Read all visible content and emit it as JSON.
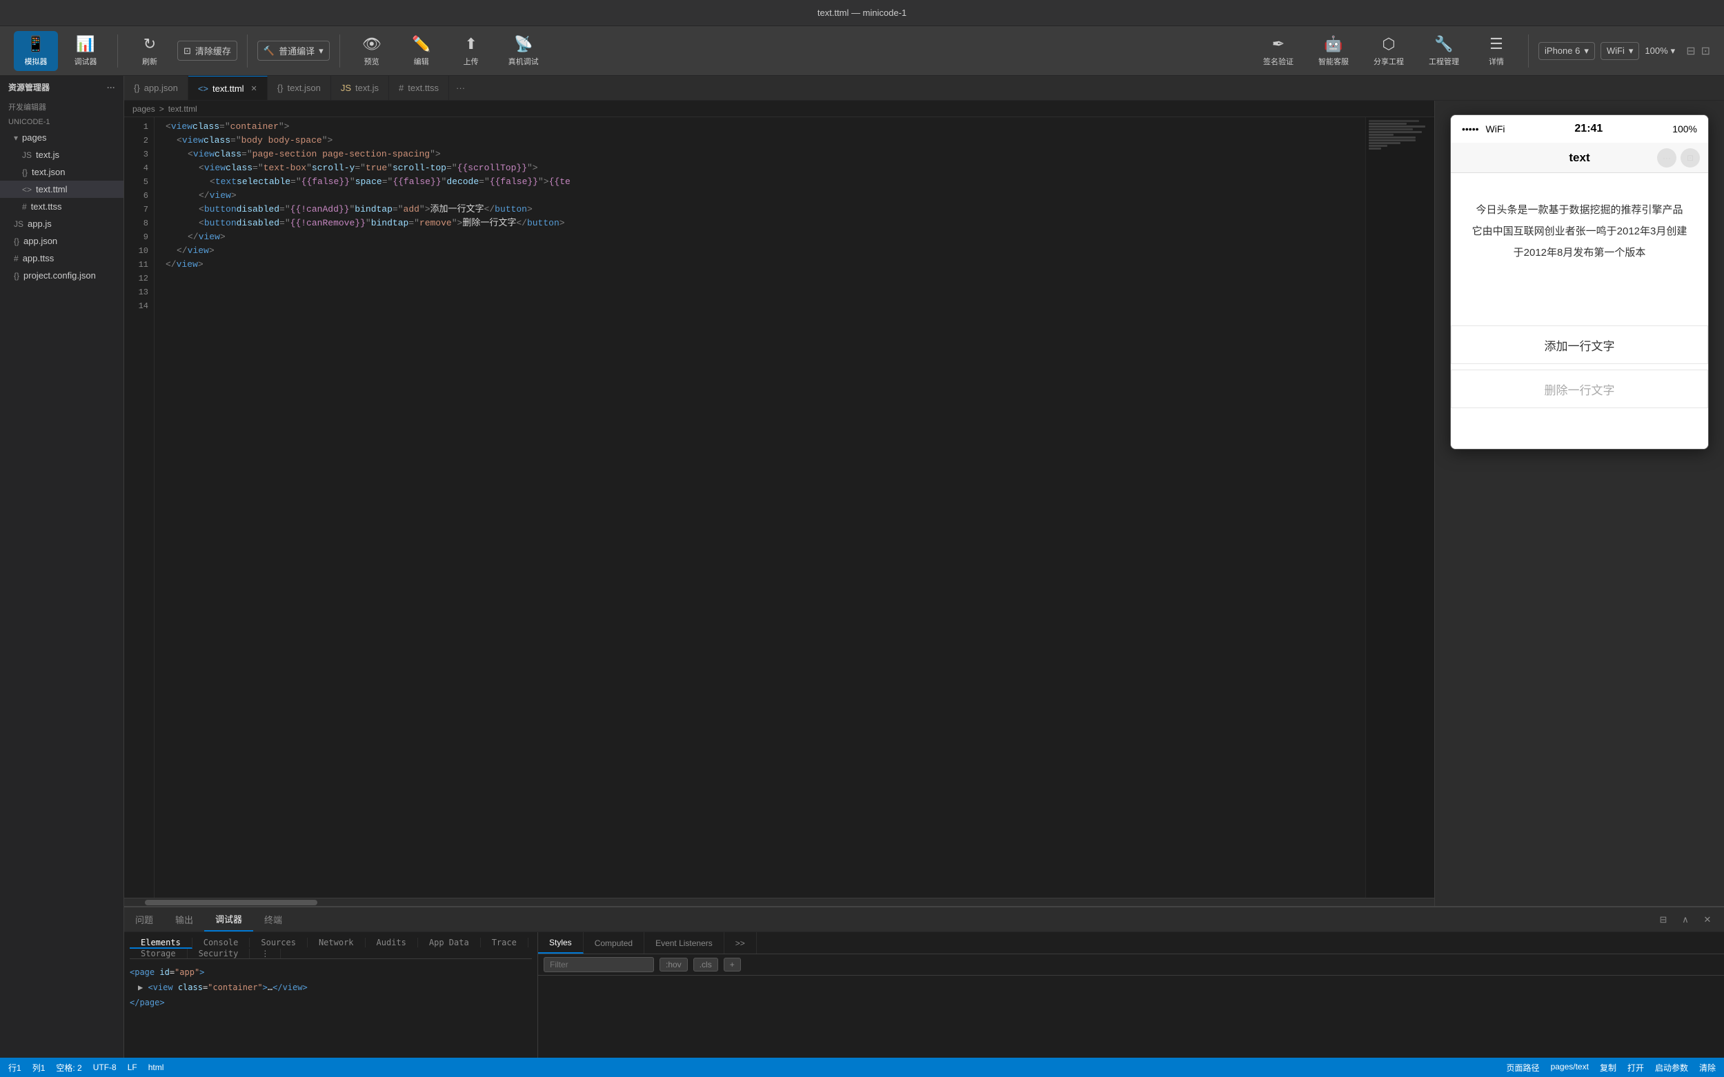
{
  "app": {
    "title": "text.ttml — minicode-1"
  },
  "toolbar": {
    "buttons": [
      {
        "id": "simulator",
        "icon": "📱",
        "label": "模拟器",
        "active": true
      },
      {
        "id": "debugger",
        "icon": "📊",
        "label": "调试器",
        "active": false
      },
      {
        "id": "refresh",
        "icon": "↻",
        "label": "刷新",
        "active": false
      },
      {
        "id": "clear-cache",
        "icon": "⊡",
        "label": "清除缓存",
        "active": false
      },
      {
        "id": "preview",
        "icon": "👁",
        "label": "预览",
        "active": false
      },
      {
        "id": "editor",
        "icon": "✏",
        "label": "编辑",
        "active": false
      },
      {
        "id": "upload",
        "icon": "↑",
        "label": "上传",
        "active": false
      },
      {
        "id": "device-debug",
        "icon": "📡",
        "label": "真机调试",
        "active": false
      },
      {
        "id": "sign",
        "icon": "✒",
        "label": "签名验证",
        "active": false
      },
      {
        "id": "ai",
        "icon": "🤖",
        "label": "智能客服",
        "active": false
      },
      {
        "id": "share",
        "icon": "⬡",
        "label": "分享工程",
        "active": false
      },
      {
        "id": "engineering",
        "icon": "🔧",
        "label": "工程管理",
        "active": false
      },
      {
        "id": "detail",
        "icon": "☰",
        "label": "详情",
        "active": false
      }
    ],
    "compile_dropdown": "普通编译",
    "device_select": "iPhone 6",
    "network_select": "WiFi",
    "zoom_select": "100%"
  },
  "sidebar": {
    "header": "资源管理器",
    "opened_label": "开发编辑器",
    "project_label": "UNICODE-1",
    "items": [
      {
        "id": "pages",
        "label": "pages",
        "type": "folder",
        "expanded": true
      },
      {
        "id": "text-js",
        "label": "text.js",
        "type": "file",
        "indent": 1
      },
      {
        "id": "text-json",
        "label": "text.json",
        "type": "file",
        "indent": 1
      },
      {
        "id": "text-ttml",
        "label": "text.ttml",
        "type": "file",
        "indent": 1,
        "active": true
      },
      {
        "id": "text-ttss",
        "label": "text.ttss",
        "type": "file",
        "indent": 1
      },
      {
        "id": "app-js",
        "label": "app.js",
        "type": "file",
        "indent": 0
      },
      {
        "id": "app-json",
        "label": "app.json",
        "type": "file",
        "indent": 0
      },
      {
        "id": "app-ttss",
        "label": "app.ttss",
        "type": "file",
        "indent": 0
      },
      {
        "id": "project-config",
        "label": "project.config.json",
        "type": "file",
        "indent": 0
      }
    ]
  },
  "tabs": [
    {
      "id": "app-json",
      "label": "app.json",
      "icon": "{}",
      "active": false,
      "closable": false
    },
    {
      "id": "text-ttml",
      "label": "text.ttml",
      "icon": "<>",
      "active": true,
      "closable": true
    },
    {
      "id": "text-json",
      "label": "text.json",
      "icon": "{}",
      "active": false,
      "closable": false
    },
    {
      "id": "text-js",
      "label": "text.js",
      "icon": "JS",
      "active": false,
      "closable": false
    },
    {
      "id": "text-ttss",
      "label": "text.ttss",
      "icon": "#",
      "active": false,
      "closable": false
    }
  ],
  "breadcrumb": {
    "parts": [
      "pages",
      ">",
      "text.ttml"
    ]
  },
  "code": {
    "lines": [
      {
        "num": 1,
        "content": "<view class=\"container\">"
      },
      {
        "num": 2,
        "content": "  <view class=\"body body-space\">"
      },
      {
        "num": 3,
        "content": "    <view class=\"page-section page-section-spacing\">"
      },
      {
        "num": 4,
        "content": "      <view class=\"text-box\" scroll-y=\"true\" scroll-top=\"{{scrollTop}}\">"
      },
      {
        "num": 5,
        "content": "        <text selectable=\"{{false}}\" space=\"{{false}}\" decode=\"{{false}}\">{{te"
      },
      {
        "num": 6,
        "content": "      </view>"
      },
      {
        "num": 7,
        "content": "      <button disabled=\"{{!canAdd}}\" bindtap=\"add\">添加一行文字</button>"
      },
      {
        "num": 8,
        "content": "      <button disabled=\"{{!canRemove}}\" bindtap=\"remove\">删除一行文字</button>"
      },
      {
        "num": 9,
        "content": "    </view>"
      },
      {
        "num": 10,
        "content": "  </view>"
      },
      {
        "num": 11,
        "content": "</view>"
      },
      {
        "num": 12,
        "content": ""
      },
      {
        "num": 13,
        "content": ""
      },
      {
        "num": 14,
        "content": ""
      }
    ]
  },
  "phone": {
    "signal": "•••••",
    "wifi": "WiFi",
    "time": "21:41",
    "battery": "100%",
    "nav_title": "text",
    "text_lines": [
      "今日头条是一款基于数据挖掘的推荐引擎产品",
      "它由中国互联网创业者张一鸣于2012年3月创建",
      "于2012年8月发布第一个版本"
    ],
    "add_btn": "添加一行文字",
    "remove_btn": "删除一行文字"
  },
  "devtools": {
    "tabs": [
      "问题",
      "输出",
      "调试器",
      "终端"
    ],
    "active_tab": "调试器",
    "subtabs": [
      "Elements",
      "Console",
      "Sources",
      "Network",
      "Audits",
      "App Data",
      "Trace",
      "Storage",
      "Security"
    ],
    "active_subtab": "Elements",
    "style_tabs": [
      "Styles",
      "Computed",
      "Event Listeners",
      ">>"
    ],
    "active_style_tab": "Styles",
    "filter_placeholder": "Filter",
    "filter_pseudo": ":hov",
    "filter_cls": ".cls",
    "dom_lines": [
      {
        "html": "<page id=\"app\">",
        "indent": 0,
        "selected": false
      },
      {
        "html": "▶ <view class=\"container\">…</view>",
        "indent": 1,
        "selected": false
      },
      {
        "html": "</page>",
        "indent": 0,
        "selected": false
      }
    ]
  },
  "status_bar": {
    "line": "行1",
    "col": "列1",
    "spaces": "空格: 2",
    "encoding": "UTF-8",
    "endings": "LF",
    "type": "html",
    "right_items": [
      "页面路径",
      "pages/text",
      "复制",
      "打开",
      "启动参数",
      "清除"
    ]
  },
  "colors": {
    "active_blue": "#0078d4",
    "tab_active_bg": "#1e1e1e",
    "sidebar_bg": "#252526",
    "toolbar_bg": "#3c3c3c",
    "status_bg": "#007acc"
  }
}
